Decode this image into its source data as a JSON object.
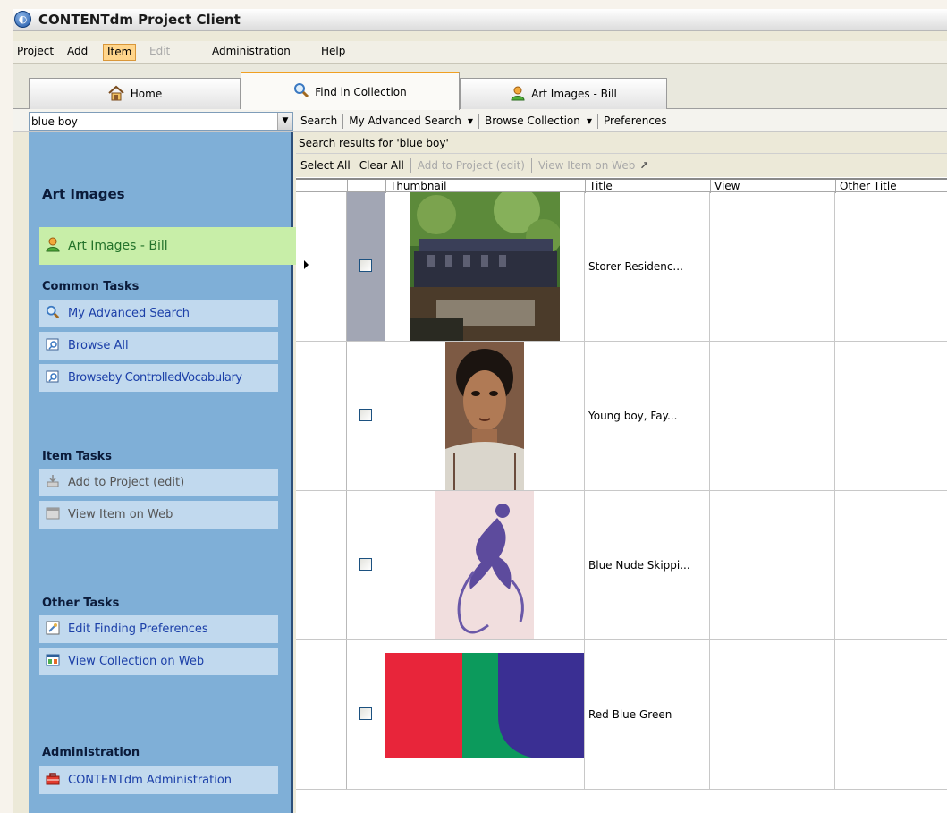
{
  "app": {
    "title": "CONTENTdm Project Client",
    "icon": "contentdm-app-icon"
  },
  "menu": [
    "Project",
    "Add",
    "Item",
    "Edit",
    "Administration",
    "Help"
  ],
  "menu_active": "Item",
  "menu_disabled": [
    "Edit"
  ],
  "tabs": [
    {
      "label": "Home",
      "icon": "home-icon",
      "active": false
    },
    {
      "label": "Find in Collection",
      "icon": "magnifier-icon",
      "active": true
    },
    {
      "label": "Art Images - Bill",
      "icon": "user-icon",
      "active": false
    }
  ],
  "search": {
    "query": "blue boy",
    "toolbar": [
      "Search",
      "My Advanced Search",
      "Browse Collection",
      "Preferences"
    ]
  },
  "sidebar": {
    "collection_title": "Art Images",
    "active_collection": "Art Images - Bill",
    "common_tasks": {
      "heading": "Common Tasks",
      "items": [
        "My Advanced Search",
        "Browse All",
        "Browseby ControlledVocabulary"
      ]
    },
    "item_tasks": {
      "heading": "Item Tasks",
      "items": [
        "Add to Project (edit)",
        "View Item on Web"
      ]
    },
    "other_tasks": {
      "heading": "Other Tasks",
      "items": [
        "Edit Finding Preferences",
        "View Collection on Web"
      ]
    },
    "administration": {
      "heading": "Administration",
      "items": [
        "CONTENTdm Administration"
      ]
    }
  },
  "results": {
    "status": "Search results for 'blue boy'",
    "actions": [
      "Select All",
      "Clear All",
      "Add to Project (edit)",
      "View Item on Web"
    ],
    "disabled_actions": [
      "Add to Project (edit)",
      "View Item on Web"
    ],
    "columns": [
      "Thumbnail",
      "Title",
      "View",
      "Other Title"
    ],
    "rows": [
      {
        "title": "Storer Residenc...",
        "thumbnail": "photo of a building terrace among trees",
        "selected": true
      },
      {
        "title": "Young boy, Fay...",
        "thumbnail": "portrait painting of a young boy",
        "selected": false
      },
      {
        "title": "Blue Nude Skippi...",
        "thumbnail": "blue cut-out figure skipping rope",
        "selected": false
      },
      {
        "title": "Red Blue Green",
        "thumbnail": "red, green and blue color field painting",
        "selected": false
      }
    ]
  },
  "colors": {
    "sidebar": "#7fafd7",
    "task_button": "#c1d9ee",
    "active_collection": "#c8eea8",
    "active_tab_accent": "#f0a022",
    "selected_checkbox_cell": "#a2a6b4"
  }
}
